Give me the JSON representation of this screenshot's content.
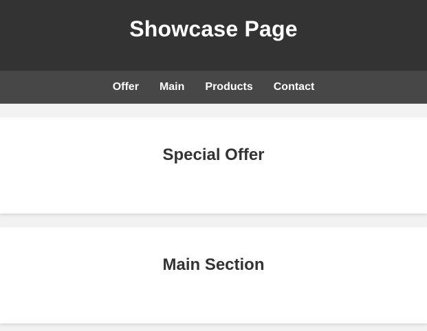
{
  "header": {
    "title": "Showcase Page"
  },
  "nav": {
    "items": [
      {
        "label": "Offer"
      },
      {
        "label": "Main"
      },
      {
        "label": "Products"
      },
      {
        "label": "Contact"
      }
    ]
  },
  "sections": [
    {
      "heading": "Special Offer"
    },
    {
      "heading": "Main Section"
    }
  ],
  "colors": {
    "header_bg": "#333333",
    "nav_bg": "#474747",
    "page_bg": "#f2f2f2",
    "card_bg": "#ffffff",
    "heading_text": "#333333",
    "nav_text": "#ffffff"
  }
}
